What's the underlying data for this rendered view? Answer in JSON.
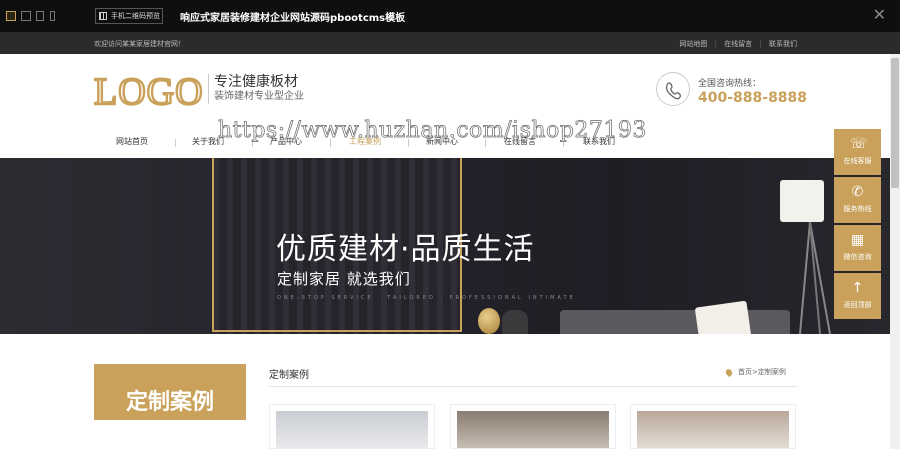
{
  "window": {
    "title": "响应式家居装修建材企业网站源码pbootcms模板",
    "qr_button": "手机二维码预览",
    "devices": [
      "desktop-icon",
      "tablet-landscape-icon",
      "tablet-portrait-icon",
      "phone-icon"
    ]
  },
  "top": {
    "welcome": "欢迎访问某某家居建材官网！",
    "links": [
      "网站地图",
      "在线留言",
      "联系我们"
    ]
  },
  "header": {
    "logo": "LOGO",
    "slogan_title": "专注健康板材",
    "slogan_sub": "装饰建材专业型企业",
    "hotline_label": "全国咨询热线：",
    "hotline": "400-888-8888"
  },
  "nav": {
    "items": [
      {
        "label": "网站首页"
      },
      {
        "label": "关于我们"
      },
      {
        "label": "产品中心"
      },
      {
        "label": "工程案例"
      },
      {
        "label": "新闻中心"
      },
      {
        "label": "在线留言"
      },
      {
        "label": "联系我们"
      }
    ],
    "active": "工程案例"
  },
  "watermark": "https://www.huzhan.com/ishop27193",
  "banner": {
    "headline": "优质建材·品质生活",
    "subline": "定制家居  就选我们",
    "tagline": "ONE-STOP SERVICE · TAILORED · PROFESSIONAL INTIMATE"
  },
  "float": [
    {
      "icon": "headset-icon",
      "glyph": "☏",
      "label": "在线客服"
    },
    {
      "icon": "phone-icon",
      "glyph": "✆",
      "label": "服务热线"
    },
    {
      "icon": "qrcode-icon",
      "glyph": "▦",
      "label": "微信咨询"
    },
    {
      "icon": "arrow-up-icon",
      "glyph": "↑",
      "label": "返回顶部"
    }
  ],
  "section": {
    "box_title": "定制案例",
    "title": "定制案例",
    "breadcrumb": "首页>定制案例"
  },
  "colors": {
    "accent": "#c9a15a",
    "topbar": "#0f0f0f",
    "banner": "#24222a"
  }
}
